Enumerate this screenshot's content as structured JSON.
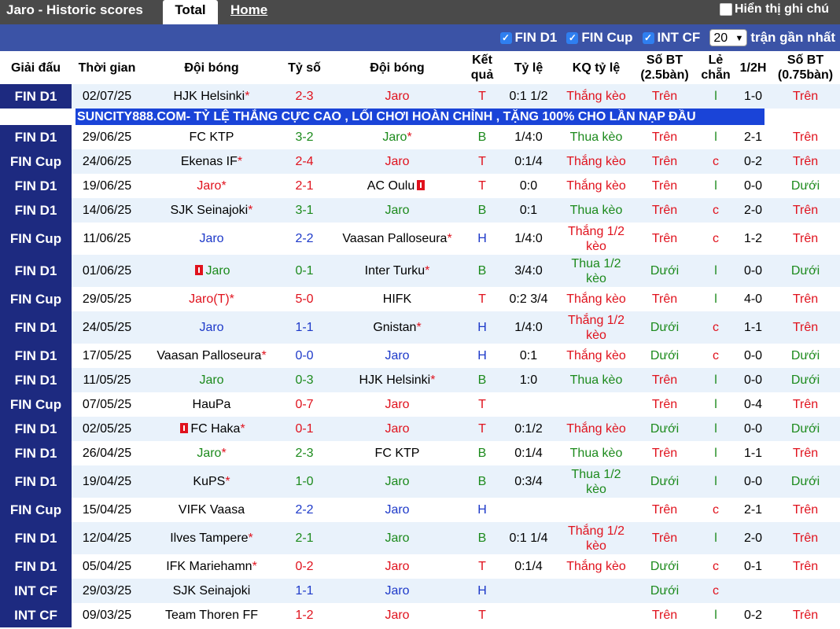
{
  "header": {
    "title": "Jaro - Historic scores",
    "tabs": [
      "Total",
      "Home"
    ],
    "hide_notes_label": "Hiển thị ghi chú"
  },
  "filters": {
    "options": [
      "FIN D1",
      "FIN Cup",
      "INT CF"
    ],
    "count_value": "20",
    "count_suffix": "trận gần nhất"
  },
  "columns": [
    "Giải đấu",
    "Thời gian",
    "Đội bóng",
    "Tỷ số",
    "Đội bóng",
    "Kết quả",
    "Tỷ lệ",
    "KQ tỷ lệ",
    "Số BT (2.5bàn)",
    "Lẻ chẵn",
    "1/2H",
    "Số BT (0.75bàn)"
  ],
  "ad_text": "SUNCITY888.COM- TỶ LỆ THẮNG CỰC CAO , LỐI CHƠI HOÀN CHỈNH , TẶNG 100% CHO LẦN NẠP ĐẦU",
  "colors": {
    "red": "#e0121d",
    "blue": "#1d39c9",
    "green": "#1c8a1c",
    "comp_bg": "#1d2a80",
    "stripe": "#e9f2fb"
  },
  "rows": [
    {
      "comp": "FIN D1",
      "date": "02/07/25",
      "home": "HJK Helsinki",
      "home_star": true,
      "home_color": "black",
      "score": "2-3",
      "away": "Jaro",
      "away_star": false,
      "away_color": "red",
      "result": "T",
      "result_color": "red",
      "odds": "0:1 1/2",
      "odds_res": "Thắng kèo",
      "odds_res_color": "red",
      "ou25": "Trên",
      "ou25_color": "red",
      "oe": "l",
      "oe_color": "green",
      "half": "1-0",
      "ou075": "Trên",
      "ou075_color": "red"
    },
    {
      "comp": "FIN D1",
      "date": "29/06/25",
      "home": "FC KTP",
      "home_star": false,
      "home_color": "black",
      "score": "3-2",
      "away": "Jaro",
      "away_star": true,
      "away_color": "green",
      "result": "B",
      "result_color": "green",
      "odds": "1/4:0",
      "odds_res": "Thua kèo",
      "odds_res_color": "green",
      "ou25": "Trên",
      "ou25_color": "red",
      "oe": "l",
      "oe_color": "green",
      "half": "2-1",
      "ou075": "Trên",
      "ou075_color": "red"
    },
    {
      "comp": "FIN Cup",
      "date": "24/06/25",
      "home": "Ekenas IF",
      "home_star": true,
      "home_color": "black",
      "score": "2-4",
      "away": "Jaro",
      "away_star": false,
      "away_color": "red",
      "result": "T",
      "result_color": "red",
      "odds": "0:1/4",
      "odds_res": "Thắng kèo",
      "odds_res_color": "red",
      "ou25": "Trên",
      "ou25_color": "red",
      "oe": "c",
      "oe_color": "red",
      "half": "0-2",
      "ou075": "Trên",
      "ou075_color": "red"
    },
    {
      "comp": "FIN D1",
      "date": "19/06/25",
      "home": "Jaro",
      "home_star": true,
      "home_color": "red",
      "score": "2-1",
      "away": "AC Oulu",
      "away_star": false,
      "away_color": "black",
      "away_card": "after",
      "result": "T",
      "result_color": "red",
      "odds": "0:0",
      "odds_res": "Thắng kèo",
      "odds_res_color": "red",
      "ou25": "Trên",
      "ou25_color": "red",
      "oe": "l",
      "oe_color": "green",
      "half": "0-0",
      "ou075": "Dưới",
      "ou075_color": "green"
    },
    {
      "comp": "FIN D1",
      "date": "14/06/25",
      "home": "SJK Seinajoki",
      "home_star": true,
      "home_color": "black",
      "score": "3-1",
      "away": "Jaro",
      "away_star": false,
      "away_color": "green",
      "result": "B",
      "result_color": "green",
      "odds": "0:1",
      "odds_res": "Thua kèo",
      "odds_res_color": "green",
      "ou25": "Trên",
      "ou25_color": "red",
      "oe": "c",
      "oe_color": "red",
      "half": "2-0",
      "ou075": "Trên",
      "ou075_color": "red"
    },
    {
      "comp": "FIN Cup",
      "date": "11/06/25",
      "home": "Jaro",
      "home_star": false,
      "home_color": "blue",
      "score": "2-2",
      "away": "Vaasan Palloseura",
      "away_star": true,
      "away_color": "black",
      "result": "H",
      "result_color": "blue",
      "odds": "1/4:0",
      "odds_res": "Thắng 1/2 kèo",
      "odds_res_color": "red",
      "ou25": "Trên",
      "ou25_color": "red",
      "oe": "c",
      "oe_color": "red",
      "half": "1-2",
      "ou075": "Trên",
      "ou075_color": "red",
      "tall": true
    },
    {
      "comp": "FIN D1",
      "date": "01/06/25",
      "home": "Jaro",
      "home_star": false,
      "home_color": "green",
      "home_card": "before",
      "score": "0-1",
      "away": "Inter Turku",
      "away_star": true,
      "away_color": "black",
      "result": "B",
      "result_color": "green",
      "odds": "3/4:0",
      "odds_res": "Thua 1/2 kèo",
      "odds_res_color": "green",
      "ou25": "Dưới",
      "ou25_color": "green",
      "oe": "l",
      "oe_color": "green",
      "half": "0-0",
      "ou075": "Dưới",
      "ou075_color": "green",
      "tall": true
    },
    {
      "comp": "FIN Cup",
      "date": "29/05/25",
      "home": "Jaro(T)",
      "home_star": true,
      "home_color": "red",
      "score": "5-0",
      "away": "HIFK",
      "away_star": false,
      "away_color": "black",
      "result": "T",
      "result_color": "red",
      "odds": "0:2 3/4",
      "odds_res": "Thắng kèo",
      "odds_res_color": "red",
      "ou25": "Trên",
      "ou25_color": "red",
      "oe": "l",
      "oe_color": "green",
      "half": "4-0",
      "ou075": "Trên",
      "ou075_color": "red"
    },
    {
      "comp": "FIN D1",
      "date": "24/05/25",
      "home": "Jaro",
      "home_star": false,
      "home_color": "blue",
      "score": "1-1",
      "away": "Gnistan",
      "away_star": true,
      "away_color": "black",
      "result": "H",
      "result_color": "blue",
      "odds": "1/4:0",
      "odds_res": "Thắng 1/2 kèo",
      "odds_res_color": "red",
      "ou25": "Dưới",
      "ou25_color": "green",
      "oe": "c",
      "oe_color": "red",
      "half": "1-1",
      "ou075": "Trên",
      "ou075_color": "red",
      "tall": true
    },
    {
      "comp": "FIN D1",
      "date": "17/05/25",
      "home": "Vaasan Palloseura",
      "home_star": true,
      "home_color": "black",
      "score": "0-0",
      "away": "Jaro",
      "away_star": false,
      "away_color": "blue",
      "result": "H",
      "result_color": "blue",
      "odds": "0:1",
      "odds_res": "Thắng kèo",
      "odds_res_color": "red",
      "ou25": "Dưới",
      "ou25_color": "green",
      "oe": "c",
      "oe_color": "red",
      "half": "0-0",
      "ou075": "Dưới",
      "ou075_color": "green"
    },
    {
      "comp": "FIN D1",
      "date": "11/05/25",
      "home": "Jaro",
      "home_star": false,
      "home_color": "green",
      "score": "0-3",
      "away": "HJK Helsinki",
      "away_star": true,
      "away_color": "black",
      "result": "B",
      "result_color": "green",
      "odds": "1:0",
      "odds_res": "Thua kèo",
      "odds_res_color": "green",
      "ou25": "Trên",
      "ou25_color": "red",
      "oe": "l",
      "oe_color": "green",
      "half": "0-0",
      "ou075": "Dưới",
      "ou075_color": "green"
    },
    {
      "comp": "FIN Cup",
      "date": "07/05/25",
      "home": "HauPa",
      "home_star": false,
      "home_color": "black",
      "score": "0-7",
      "away": "Jaro",
      "away_star": false,
      "away_color": "red",
      "result": "T",
      "result_color": "red",
      "odds": "",
      "odds_res": "",
      "odds_res_color": "red",
      "ou25": "Trên",
      "ou25_color": "red",
      "oe": "l",
      "oe_color": "green",
      "half": "0-4",
      "ou075": "Trên",
      "ou075_color": "red"
    },
    {
      "comp": "FIN D1",
      "date": "02/05/25",
      "home": "FC Haka",
      "home_star": true,
      "home_color": "black",
      "home_card": "before",
      "score": "0-1",
      "away": "Jaro",
      "away_star": false,
      "away_color": "red",
      "result": "T",
      "result_color": "red",
      "odds": "0:1/2",
      "odds_res": "Thắng kèo",
      "odds_res_color": "red",
      "ou25": "Dưới",
      "ou25_color": "green",
      "oe": "l",
      "oe_color": "green",
      "half": "0-0",
      "ou075": "Dưới",
      "ou075_color": "green"
    },
    {
      "comp": "FIN D1",
      "date": "26/04/25",
      "home": "Jaro",
      "home_star": true,
      "home_color": "green",
      "score": "2-3",
      "away": "FC KTP",
      "away_star": false,
      "away_color": "black",
      "result": "B",
      "result_color": "green",
      "odds": "0:1/4",
      "odds_res": "Thua kèo",
      "odds_res_color": "green",
      "ou25": "Trên",
      "ou25_color": "red",
      "oe": "l",
      "oe_color": "green",
      "half": "1-1",
      "ou075": "Trên",
      "ou075_color": "red"
    },
    {
      "comp": "FIN D1",
      "date": "19/04/25",
      "home": "KuPS",
      "home_star": true,
      "home_color": "black",
      "score": "1-0",
      "away": "Jaro",
      "away_star": false,
      "away_color": "green",
      "result": "B",
      "result_color": "green",
      "odds": "0:3/4",
      "odds_res": "Thua 1/2 kèo",
      "odds_res_color": "green",
      "ou25": "Dưới",
      "ou25_color": "green",
      "oe": "l",
      "oe_color": "green",
      "half": "0-0",
      "ou075": "Dưới",
      "ou075_color": "green",
      "tall": true
    },
    {
      "comp": "FIN Cup",
      "date": "15/04/25",
      "home": "VIFK Vaasa",
      "home_star": false,
      "home_color": "black",
      "score": "2-2",
      "away": "Jaro",
      "away_star": false,
      "away_color": "blue",
      "result": "H",
      "result_color": "blue",
      "odds": "",
      "odds_res": "",
      "odds_res_color": "red",
      "ou25": "Trên",
      "ou25_color": "red",
      "oe": "c",
      "oe_color": "red",
      "half": "2-1",
      "ou075": "Trên",
      "ou075_color": "red"
    },
    {
      "comp": "FIN D1",
      "date": "12/04/25",
      "home": "Ilves Tampere",
      "home_star": true,
      "home_color": "black",
      "score": "2-1",
      "away": "Jaro",
      "away_star": false,
      "away_color": "green",
      "result": "B",
      "result_color": "green",
      "odds": "0:1 1/4",
      "odds_res": "Thắng 1/2 kèo",
      "odds_res_color": "red",
      "ou25": "Trên",
      "ou25_color": "red",
      "oe": "l",
      "oe_color": "green",
      "half": "2-0",
      "ou075": "Trên",
      "ou075_color": "red",
      "tall": true
    },
    {
      "comp": "FIN D1",
      "date": "05/04/25",
      "home": "IFK Mariehamn",
      "home_star": true,
      "home_color": "black",
      "score": "0-2",
      "away": "Jaro",
      "away_star": false,
      "away_color": "red",
      "result": "T",
      "result_color": "red",
      "odds": "0:1/4",
      "odds_res": "Thắng kèo",
      "odds_res_color": "red",
      "ou25": "Dưới",
      "ou25_color": "green",
      "oe": "c",
      "oe_color": "red",
      "half": "0-1",
      "ou075": "Trên",
      "ou075_color": "red"
    },
    {
      "comp": "INT CF",
      "date": "29/03/25",
      "home": "SJK Seinajoki",
      "home_star": false,
      "home_color": "black",
      "score": "1-1",
      "away": "Jaro",
      "away_star": false,
      "away_color": "blue",
      "result": "H",
      "result_color": "blue",
      "odds": "",
      "odds_res": "",
      "odds_res_color": "red",
      "ou25": "Dưới",
      "ou25_color": "green",
      "oe": "c",
      "oe_color": "red",
      "half": "",
      "ou075": "",
      "ou075_color": "red"
    },
    {
      "comp": "INT CF",
      "date": "09/03/25",
      "home": "Team Thoren FF",
      "home_star": false,
      "home_color": "black",
      "score": "1-2",
      "away": "Jaro",
      "away_star": false,
      "away_color": "red",
      "result": "T",
      "result_color": "red",
      "odds": "",
      "odds_res": "",
      "odds_res_color": "red",
      "ou25": "Trên",
      "ou25_color": "red",
      "oe": "l",
      "oe_color": "green",
      "half": "0-2",
      "ou075": "Trên",
      "ou075_color": "red"
    }
  ]
}
